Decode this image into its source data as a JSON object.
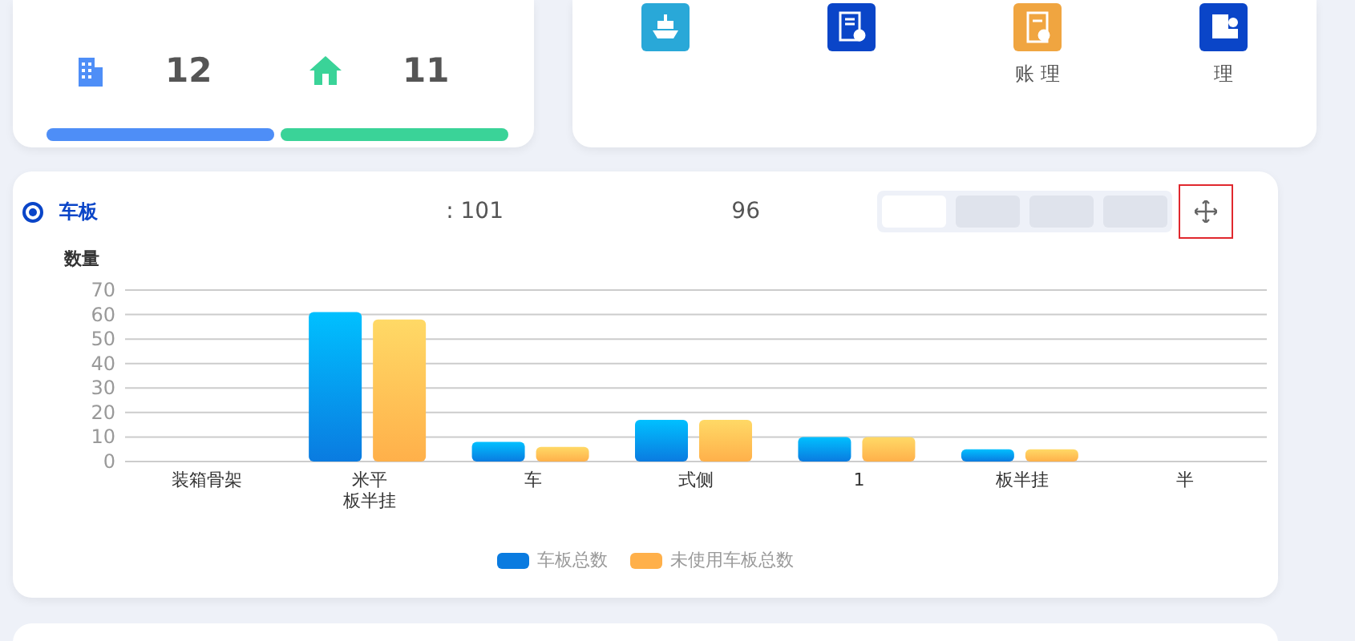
{
  "stat_cards": [
    {
      "kind": "building",
      "value": "12",
      "color": "#4e8ef7",
      "level": 1
    },
    {
      "kind": "house",
      "value": "11",
      "color": "#3ad398",
      "level": 1
    }
  ],
  "shortcuts": [
    {
      "kind": "ship",
      "color": "#29a8d8"
    },
    {
      "kind": "doc",
      "color": "#0a45c8"
    },
    {
      "kind": "ledger",
      "color": "#f0a540",
      "label": "账  理"
    },
    {
      "kind": "calc",
      "color": "#0a45c8",
      "label": "理"
    }
  ],
  "panel": {
    "radio": {
      "label": "车板",
      "selected": true
    },
    "stat_1": ": 101",
    "stat_2": "96",
    "tabs": [
      {
        "selected": true
      },
      {
        "selected": false
      },
      {
        "selected": false
      },
      {
        "selected": false
      }
    ],
    "chart_data": {
      "type": "bar",
      "ylabel": "数量",
      "grid": true,
      "categories": [
        "装箱骨架",
        "米平板半挂",
        "车",
        "式侧",
        "1",
        "板半挂",
        "半"
      ],
      "ylim": [
        0,
        70
      ],
      "yticks": [
        0,
        10,
        20,
        30,
        40,
        50,
        60,
        70
      ],
      "series": [
        {
          "name": "车板总数",
          "color": "#0a7be0",
          "values": [
            0,
            61,
            8,
            17,
            10,
            5,
            0
          ]
        },
        {
          "name": "未使用车板总数",
          "color": "#ffb04a",
          "values": [
            0,
            58,
            6,
            17,
            10,
            5,
            0
          ]
        }
      ]
    }
  }
}
